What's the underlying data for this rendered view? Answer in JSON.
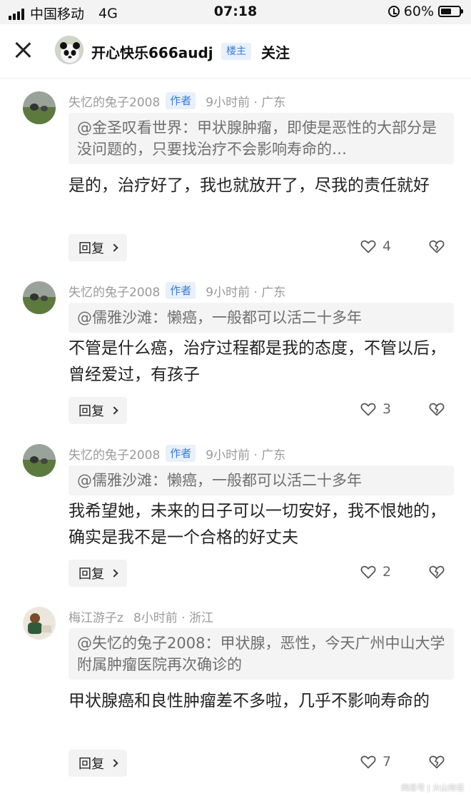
{
  "status_bar": {
    "carrier": "中国移动",
    "network": "4G",
    "time": "07:18",
    "battery": "60%",
    "battery_level": 0.6
  },
  "header": {
    "username": "开心快乐666audj",
    "op_badge": "楼主",
    "follow_label": "关注"
  },
  "comments": [
    {
      "author": "失忆的兔子2008",
      "author_badge": "作者",
      "time_location": "9小时前 · 广东",
      "quote": "@金圣叹看世界：甲状腺肿瘤，即使是恶性的大部分是没问题的，只要找治疗不会影响寿命的…",
      "body": "是的，治疗好了，我也就放开了，尽我的责任就好",
      "reply_label": "回复",
      "likes": "4"
    },
    {
      "author": "失忆的兔子2008",
      "author_badge": "作者",
      "time_location": "9小时前 · 广东",
      "quote": "@儒雅沙滩：懒癌，一般都可以活二十多年",
      "body": "不管是什么癌，治疗过程都是我的态度，不管以后，曾经爱过，有孩子",
      "reply_label": "回复",
      "likes": "3"
    },
    {
      "author": "失忆的兔子2008",
      "author_badge": "作者",
      "time_location": "9小时前 · 广东",
      "quote": "@儒雅沙滩：懒癌，一般都可以活二十多年",
      "body": "我希望她，未来的日子可以一切安好，我不恨她的，确实是我不是一个合格的好丈夫",
      "reply_label": "回复",
      "likes": "2"
    },
    {
      "author": "梅江游子z",
      "author_badge": "",
      "time_location": "8小时前 · 浙江",
      "quote": "@失忆的兔子2008：甲状腺，恶性，今天广州中山大学附属肿瘤医院再次确诊的",
      "body": "甲状腺癌和良性肿瘤差不多啦，几乎不影响寿命的",
      "reply_label": "回复",
      "likes": "7"
    }
  ],
  "watermark": "网易号 | 火山诗话"
}
